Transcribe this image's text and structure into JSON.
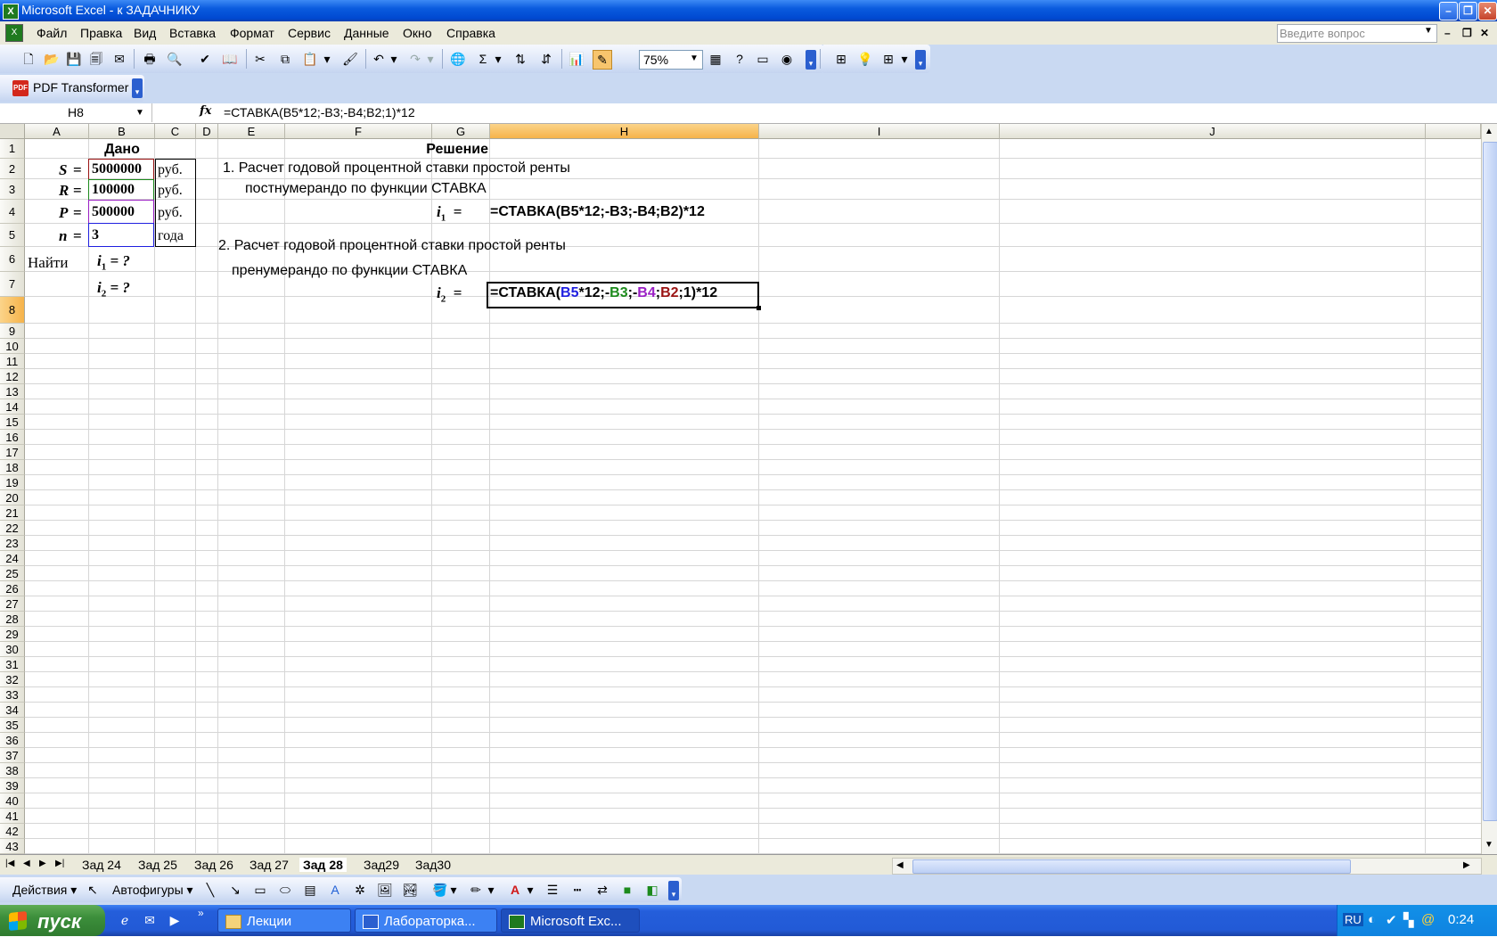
{
  "window": {
    "title": "Microsoft Excel - к ЗАДАЧНИКУ"
  },
  "menu": [
    "Файл",
    "Правка",
    "Вид",
    "Вставка",
    "Формат",
    "Сервис",
    "Данные",
    "Окно",
    "Справка"
  ],
  "help_placeholder": "Введите вопрос",
  "toolbar": {
    "zoom": "75%",
    "pdf_label": "PDF Transformer"
  },
  "formula_bar": {
    "cell_ref": "H8",
    "fx": "fx",
    "formula": "=СТАВКА(B5*12;-B3;-B4;B2;1)*12"
  },
  "columns": [
    "A",
    "B",
    "C",
    "D",
    "E",
    "F",
    "G",
    "H",
    "I",
    "J"
  ],
  "selected_column": "H",
  "selected_row": 8,
  "sheet": {
    "dano": "Дано",
    "reshenie": "Решение",
    "given": [
      {
        "var": "S",
        "eq": "=",
        "value": "5000000",
        "unit": "руб."
      },
      {
        "var": "R",
        "eq": "=",
        "value": "100000",
        "unit": "руб."
      },
      {
        "var": "P",
        "eq": "=",
        "value": "500000",
        "unit": "руб."
      },
      {
        "var": "n",
        "eq": "=",
        "value": "3",
        "unit": "года"
      }
    ],
    "find_label": "Найти",
    "i1_var": "i",
    "i1_sub": "1",
    "i1_eq": "= ?",
    "i2_var": "i",
    "i2_sub": "2",
    "i2_eq": "= ?",
    "task1_line1": "1. Расчет годовой процентной ставки простой ренты",
    "task1_line2": "постнумерандо по функции СТАВКА",
    "task1_lhs_var": "i",
    "task1_lhs_sub": "1",
    "task1_lhs_eq": "=",
    "task1_formula": "=СТАВКА(B5*12;-B3;-B4;B2)*12",
    "task2_line1": "2. Расчет годовой процентной ставки простой ренты",
    "task2_line2": "пренумерандо по функции СТАВКА",
    "task2_lhs_var": "i",
    "task2_lhs_sub": "2",
    "task2_lhs_eq": "=",
    "task2_formula_parts": [
      {
        "text": "=СТАВКА(",
        "color": "#000000"
      },
      {
        "text": "B5",
        "color": "#1f1fe0"
      },
      {
        "text": "*12;-",
        "color": "#000000"
      },
      {
        "text": "B3",
        "color": "#1c8a1c"
      },
      {
        "text": ";-",
        "color": "#000000"
      },
      {
        "text": "B4",
        "color": "#9a1fc4"
      },
      {
        "text": ";",
        "color": "#000000"
      },
      {
        "text": "B2",
        "color": "#9a1313"
      },
      {
        "text": ";1)*12",
        "color": "#000000"
      }
    ]
  },
  "sheet_tabs": [
    "Зад 24",
    "Зад 25",
    "Зад 26",
    "Зад 27",
    "Зад 28",
    "Зад29",
    "Зад30"
  ],
  "active_tab": "Зад 28",
  "drawbar": {
    "actions": "Действия",
    "autoshapes": "Автофигуры"
  },
  "taskbar": {
    "start": "пуск",
    "tasks": [
      "Лекции",
      "Лабораторка...",
      "Microsoft Exc..."
    ],
    "lang": "RU",
    "clock": "0:24"
  },
  "colors": {
    "title_bar": "#0a5bde",
    "selection": "#f6b34a",
    "taskbar": "#245edb",
    "start": "#3c8e3b"
  }
}
